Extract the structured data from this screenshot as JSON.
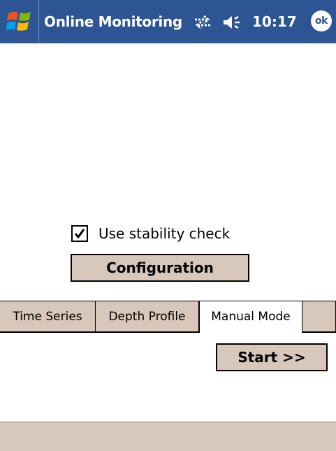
{
  "title_bar": {
    "app_title": "Online Monitoring",
    "time": "10:17",
    "ok_label": "ok",
    "icons": [
      "windows-start-icon",
      "connectivity-icon",
      "volume-icon"
    ],
    "background_color": "#2d5594"
  },
  "options": {
    "stability_check": {
      "label": "Use stability check",
      "checked": true
    },
    "configuration_button": "Configuration"
  },
  "tabs": [
    {
      "label": "Time Series",
      "active": false
    },
    {
      "label": "Depth Profile",
      "active": false
    },
    {
      "label": "Manual Mode",
      "active": true
    }
  ],
  "manual_mode": {
    "start_button": "Start >>"
  },
  "theme": {
    "button_face": "#d8c8bb"
  }
}
